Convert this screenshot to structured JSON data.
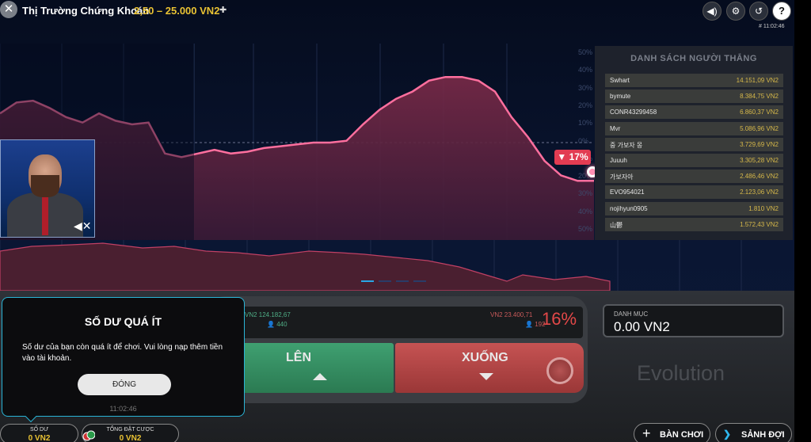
{
  "header": {
    "title": "Thị Trường Chứng Khoán",
    "bet_range": "2,50 – 25.000 VN2",
    "round_id": "# 11:02:46",
    "icons": [
      "close-icon",
      "pin-icon",
      "volume-icon",
      "gear-icon",
      "history-icon",
      "help-icon"
    ]
  },
  "chart": {
    "pct_scale": [
      "50%",
      "40%",
      "30%",
      "20%",
      "10%",
      "0%",
      "10%",
      "20%",
      "30%",
      "40%",
      "50%"
    ],
    "current_badge": "17%",
    "accent": "#e23c52"
  },
  "chart_data": {
    "type": "area",
    "title": "",
    "ylim": [
      -50,
      50
    ],
    "y": [
      16,
      22,
      23,
      19,
      14,
      11,
      16,
      12,
      10,
      11,
      -6,
      -8,
      -6,
      -4,
      -6,
      -5,
      -3,
      -2,
      -1,
      0,
      0,
      1,
      10,
      18,
      24,
      28,
      34,
      36,
      36,
      34,
      28,
      14,
      3,
      -10,
      -18,
      -21,
      -21
    ]
  },
  "video": {
    "muted": true
  },
  "winners": {
    "title": "DANH SÁCH NGƯỜI THẮNG",
    "rows": [
      {
        "name": "Swhart",
        "amount": "14.151,09 VN2"
      },
      {
        "name": "bymute",
        "amount": "8.384,75 VN2"
      },
      {
        "name": "CONR43299458",
        "amount": "6.860,37 VN2"
      },
      {
        "name": "Mvr",
        "amount": "5.086,96 VN2"
      },
      {
        "name": "중 가보자 몽",
        "amount": "3.729,69 VN2"
      },
      {
        "name": "Juuuh",
        "amount": "3.305,28 VN2"
      },
      {
        "name": "가보자아",
        "amount": "2.486,46 VN2"
      },
      {
        "name": "EVO954021",
        "amount": "2.123,06 VN2"
      },
      {
        "name": "nojihyun0905",
        "amount": "1.810 VN2"
      },
      {
        "name": "山鬱",
        "amount": "1.572,43 VN2"
      }
    ]
  },
  "betting": {
    "up_total": "VN2 124.182,67",
    "up_count": "440",
    "down_total": "VN2 23.400,71",
    "down_count": "192",
    "down_pct": "16%",
    "up_label": "LÊN",
    "down_label": "XUỐNG"
  },
  "category": {
    "label": "DANH MỤC",
    "value": "0.00 VN2"
  },
  "brand": "Evolution",
  "footer": {
    "balance_label": "SỐ DƯ",
    "balance_value": "0 VN2",
    "total_bet_label": "TỔNG ĐẶT CƯỢC",
    "total_bet_value": "0 VN2",
    "play_tables": "BÀN CHƠI",
    "lobby": "SẢNH ĐỢI"
  },
  "modal": {
    "title": "SỐ DƯ QUÁ ÍT",
    "body": "Số dư của bạn còn quá ít để chơi. Vui lòng nạp thêm tiền vào tài khoản.",
    "close_label": "ĐÓNG",
    "time": "11:02:46"
  }
}
